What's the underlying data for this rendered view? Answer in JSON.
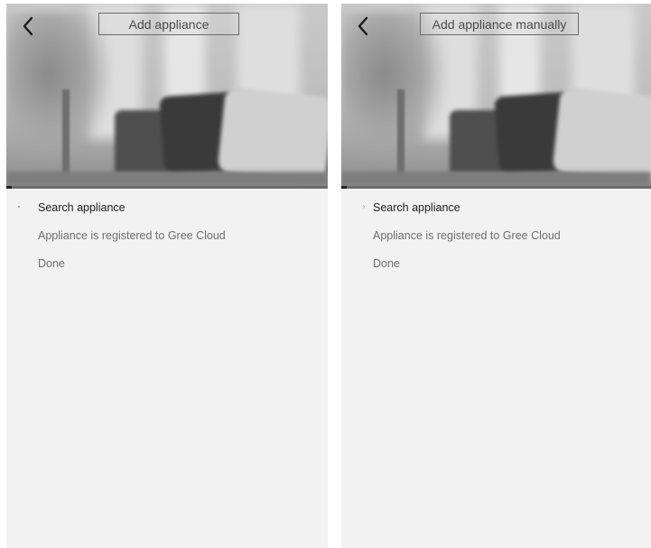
{
  "screens": [
    {
      "id": "left",
      "title": "Add appliance",
      "back_icon": "chevron-left-icon",
      "steps": [
        {
          "label": "Search appliance",
          "state": "active"
        },
        {
          "label": "Appliance is registered to Gree Cloud",
          "state": "pending"
        },
        {
          "label": "Done",
          "state": "pending"
        }
      ]
    },
    {
      "id": "right",
      "title": "Add appliance manually",
      "back_icon": "chevron-left-icon",
      "steps": [
        {
          "label": "Search appliance",
          "state": "active"
        },
        {
          "label": "Appliance is registered to Gree Cloud",
          "state": "pending"
        },
        {
          "label": "Done",
          "state": "pending"
        }
      ]
    }
  ],
  "colors": {
    "background": "#f2f2f2",
    "active_text": "#1e1e1e",
    "pending_text": "#6e6e6e",
    "title_border": "#6a6a6a"
  }
}
